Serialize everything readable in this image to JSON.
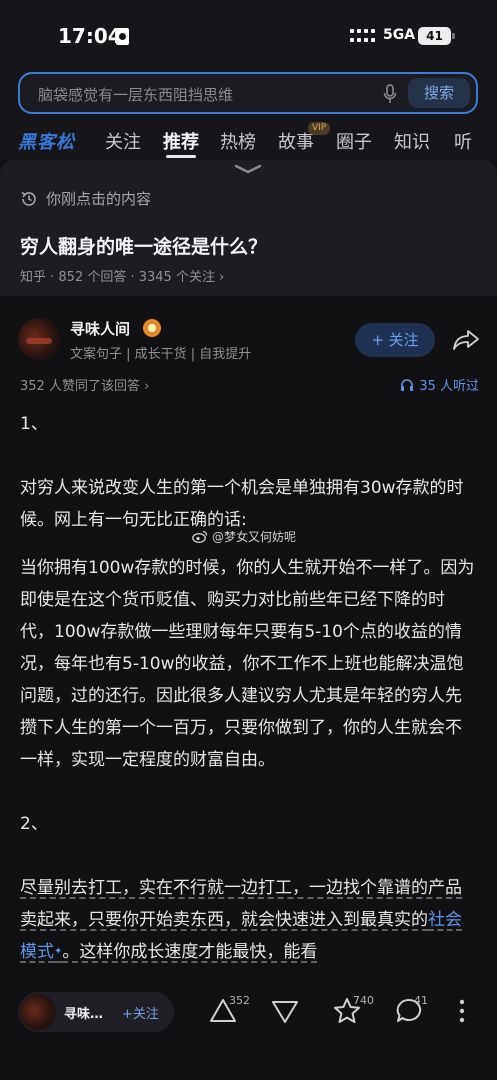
{
  "status": {
    "time": "17:04",
    "network": "5GA",
    "battery": "41"
  },
  "search": {
    "placeholder": "脑袋感觉有一层东西阻挡思维",
    "button": "搜索"
  },
  "tabs": [
    {
      "label": "黑客松"
    },
    {
      "label": "关注"
    },
    {
      "label": "推荐"
    },
    {
      "label": "热榜"
    },
    {
      "label": "故事"
    },
    {
      "label": "圈子"
    },
    {
      "label": "知识"
    },
    {
      "label": "听"
    }
  ],
  "vip_badge": "VIP",
  "recent": {
    "label": "你刚点击的内容"
  },
  "question": {
    "title": "穷人翻身的唯一途径是什么？",
    "meta": "知乎 · 852 个回答 · 3345 个关注 ›"
  },
  "answer": {
    "author": "寻味人间",
    "desc": "文案句子 | 成长干货 | 自我提升",
    "follow": "+ 关注",
    "likes_line": "352 人赞同了该回答 ›",
    "listen": "35 人听过",
    "watermark": "@梦女又何妨呢",
    "p1": "1、",
    "p2": "对穷人来说改变人生的第一个机会是单独拥有30w存款的时候。网上有一句无比正确的话:",
    "p3": "当你拥有100w存款的时候，你的人生就开始不一样了。因为即使是在这个货币贬值、购买力对比前些年已经下降的时代，100w存款做一些理财每年只要有5-10个点的收益的情况，每年也有5-10w的收益，你不工作不上班也能解决温饱问题，过的还行。因此很多人建议穷人尤其是年轻的穷人先攒下人生的第一个一百万，只要你做到了，你的人生就会不一样，实现一定程度的财富自由。",
    "p4": "2、",
    "p5a": "尽量别去打工，实在不行就一边打工，一边找个靠谱的产品卖起来，只要你开始卖东西，就会快速进入到最真实的",
    "p5link": "社会模式",
    "p5b": "。这样你成长速度才能最快，能看"
  },
  "bottom": {
    "name": "寻味…",
    "follow": "+关注",
    "upvotes": "352",
    "favorites": "740",
    "comments": "41"
  }
}
